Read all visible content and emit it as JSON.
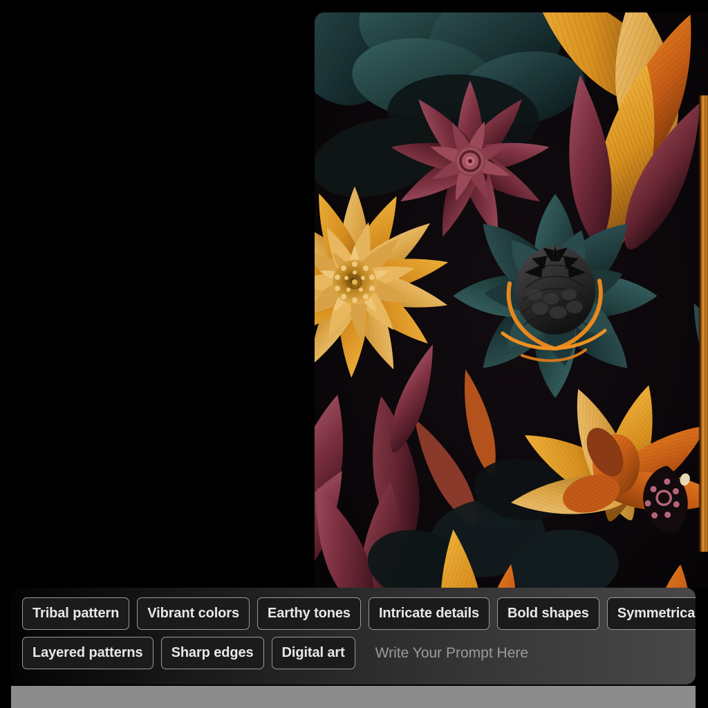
{
  "app": {
    "background_color": "#000000",
    "accent_color": "#e3902a"
  },
  "image_panel": {
    "name": "generated-image",
    "alt": "Dark floral digital artwork with gold, maroon and teal flowers",
    "palette": {
      "background": "#0a0608",
      "gold": "#e0a94a",
      "gold_light": "#efc779",
      "gold_deep": "#c07a1e",
      "orange": "#d4691f",
      "orange_bright": "#f09020",
      "maroon": "#7d3040",
      "maroon_light": "#a8566a",
      "rose": "#b5657a",
      "teal": "#1f3a3c",
      "teal_light": "#2f5255",
      "teal_dark": "#14282a",
      "charcoal": "#2a2a2a",
      "near_black": "#0d0a0c"
    },
    "edge_strip_color": "#e3902a"
  },
  "prompt_bar": {
    "chips_row_1": [
      "Tribal pattern",
      "Vibrant colors",
      "Earthy tones",
      "Intricate details",
      "Bold shapes",
      "Symmetrical design"
    ],
    "chips_row_2": [
      "Layered patterns",
      "Sharp edges",
      "Digital art"
    ],
    "input": {
      "value": "",
      "placeholder": "Write Your Prompt Here"
    }
  }
}
